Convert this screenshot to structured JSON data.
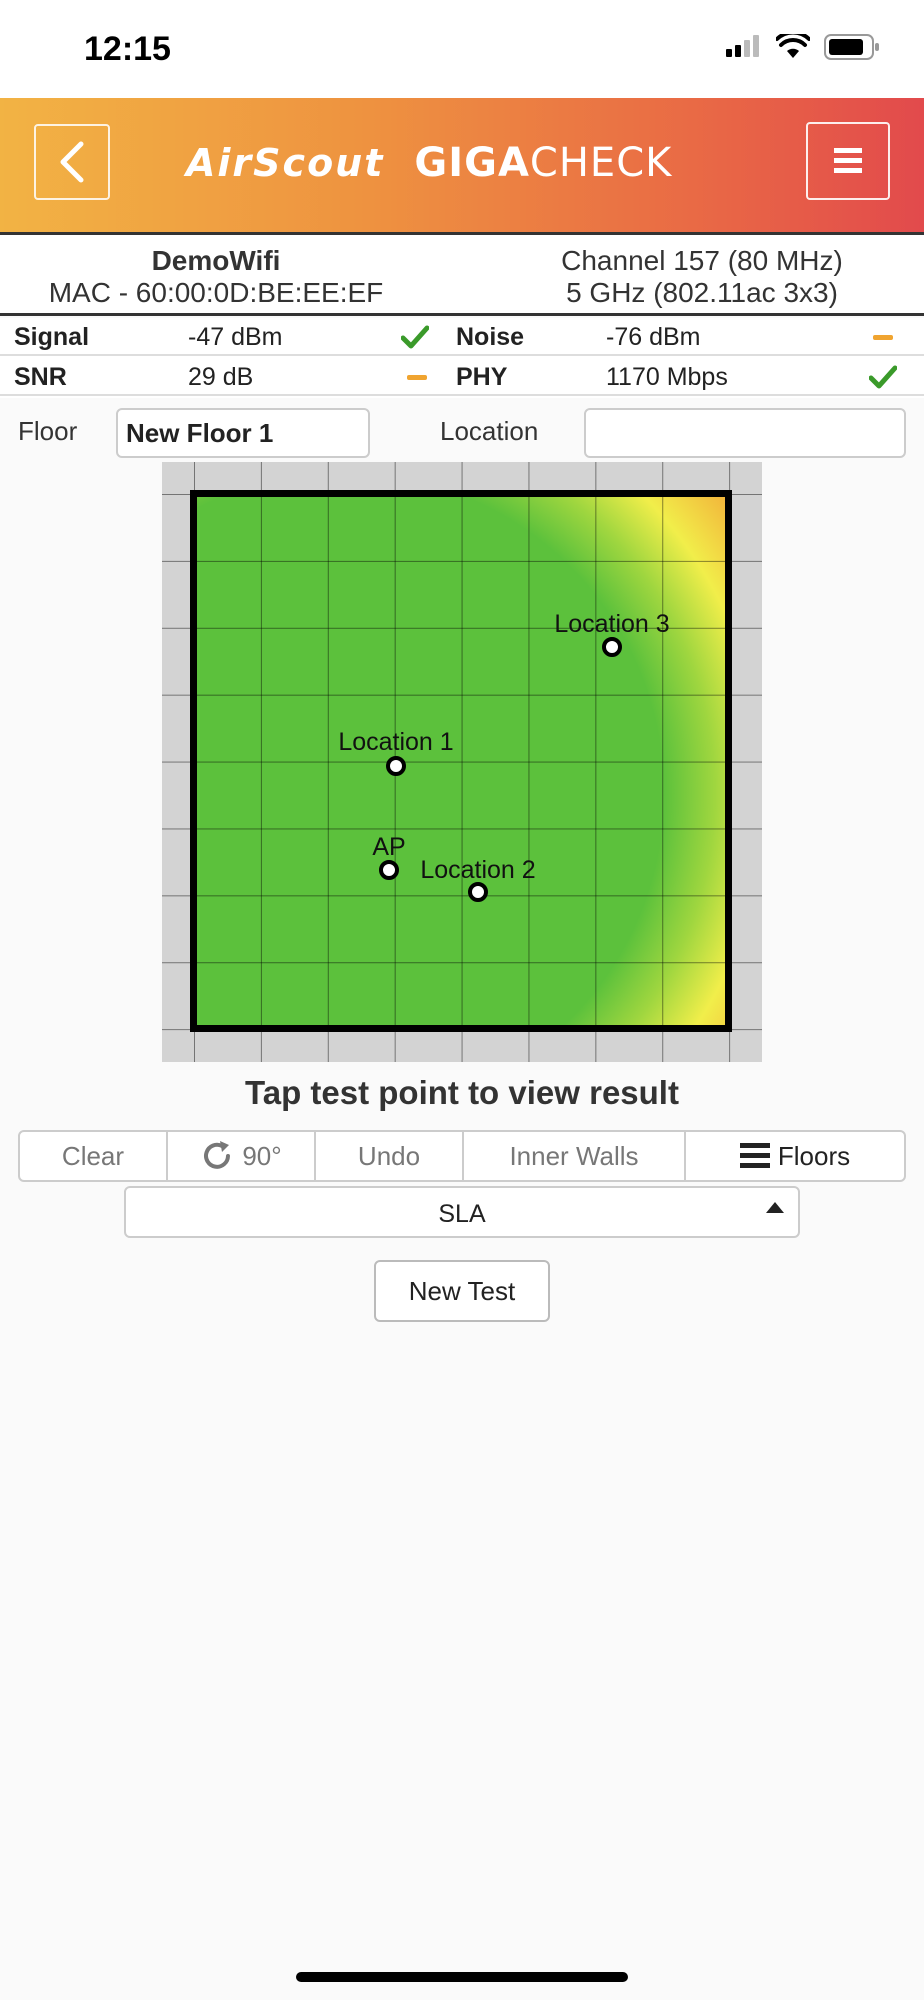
{
  "status_bar": {
    "time": "12:15",
    "icons": [
      "signal-icon",
      "wifi-icon",
      "battery-icon"
    ]
  },
  "header": {
    "brand_air": "AirScout",
    "brand_giga_bold": "GIGA",
    "brand_giga_rest": "CHECK",
    "gradient_colors": [
      "#f2b344",
      "#e24a4c"
    ]
  },
  "network": {
    "ssid": "DemoWifi",
    "mac": "MAC - 60:00:0D:BE:EE:EF",
    "channel": "Channel 157 (80 MHz)",
    "band": "5 GHz (802.11ac 3x3)"
  },
  "metrics": [
    {
      "label": "Signal",
      "value": "-47 dBm",
      "status": "good"
    },
    {
      "label": "Noise",
      "value": "-76 dBm",
      "status": "fair"
    },
    {
      "label": "SNR",
      "value": "29 dB",
      "status": "fair"
    },
    {
      "label": "PHY",
      "value": "1170 Mbps",
      "status": "good"
    }
  ],
  "floor": {
    "label": "Floor",
    "value": "New Floor 1"
  },
  "location": {
    "label": "Location",
    "value": ""
  },
  "map": {
    "points": [
      {
        "name": "Location 3"
      },
      {
        "name": "Location 1"
      },
      {
        "name": "AP"
      },
      {
        "name": "Location 2"
      }
    ],
    "heat_colors": {
      "good": "#5cc13c",
      "fair": "#f1ee4a",
      "poor": "#d93022"
    }
  },
  "hint": "Tap test point to view result",
  "toolbar": {
    "clear": "Clear",
    "rotate": "90°",
    "undo": "Undo",
    "inner_walls": "Inner Walls",
    "floors": "Floors"
  },
  "sla": {
    "selected": "SLA"
  },
  "new_test": "New Test",
  "colors": {
    "check": "#3a9a2a",
    "dash": "#f0a430"
  }
}
